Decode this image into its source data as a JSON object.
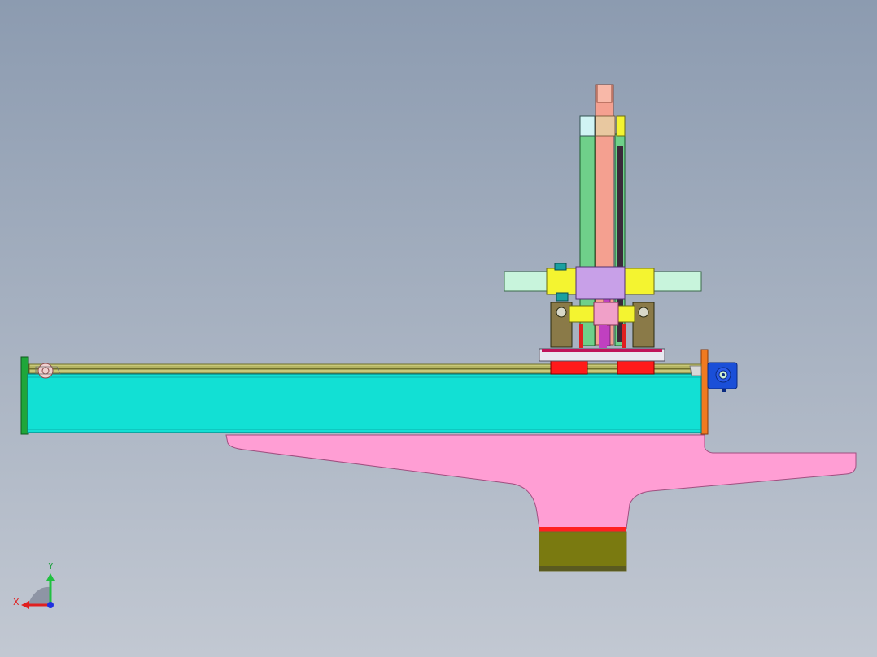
{
  "viewport": {
    "background_top": "#8c9bb0",
    "background_bottom": "#c2c8d2"
  },
  "colors": {
    "base_beam": "#12e0d4",
    "base_beam_stroke": "#0a7f80",
    "rail": "#c9c97a",
    "rail_dark": "#6f6f2a",
    "left_end_plate": "#1fa63a",
    "right_end_plate": "#f07a20",
    "motor": "#1a4fd8",
    "pedestal": "#ff9ed4",
    "pedestal_stroke": "#a04f80",
    "pedestal_band": "#ff2020",
    "pedestal_foot": "#7a7a10",
    "carriage_block": "#ff1a1a",
    "carriage_plate": "#e8e8f0",
    "carriage_plate_accent": "#c0145a",
    "column_green": "#6fd08a",
    "column_salmon": "#f4a090",
    "column_dark": "#3a2a3a",
    "column_magenta": "#c040c0",
    "cylinder_yellow": "#f4f430",
    "cylinder_mint": "#c8f4dc",
    "bearing_housing": "#8a7a48",
    "teal_box": "#1aa0a0",
    "top_block_pale": "#d0f4f4"
  },
  "icons": {
    "motor": "servo-motor-icon",
    "pulley": "idler-pulley-icon",
    "triad": "coordinate-triad-icon"
  },
  "triad": {
    "x_label": "X",
    "y_label": "Y",
    "x_color": "#e02020",
    "y_color": "#20c040",
    "z_color": "#2030e0"
  }
}
